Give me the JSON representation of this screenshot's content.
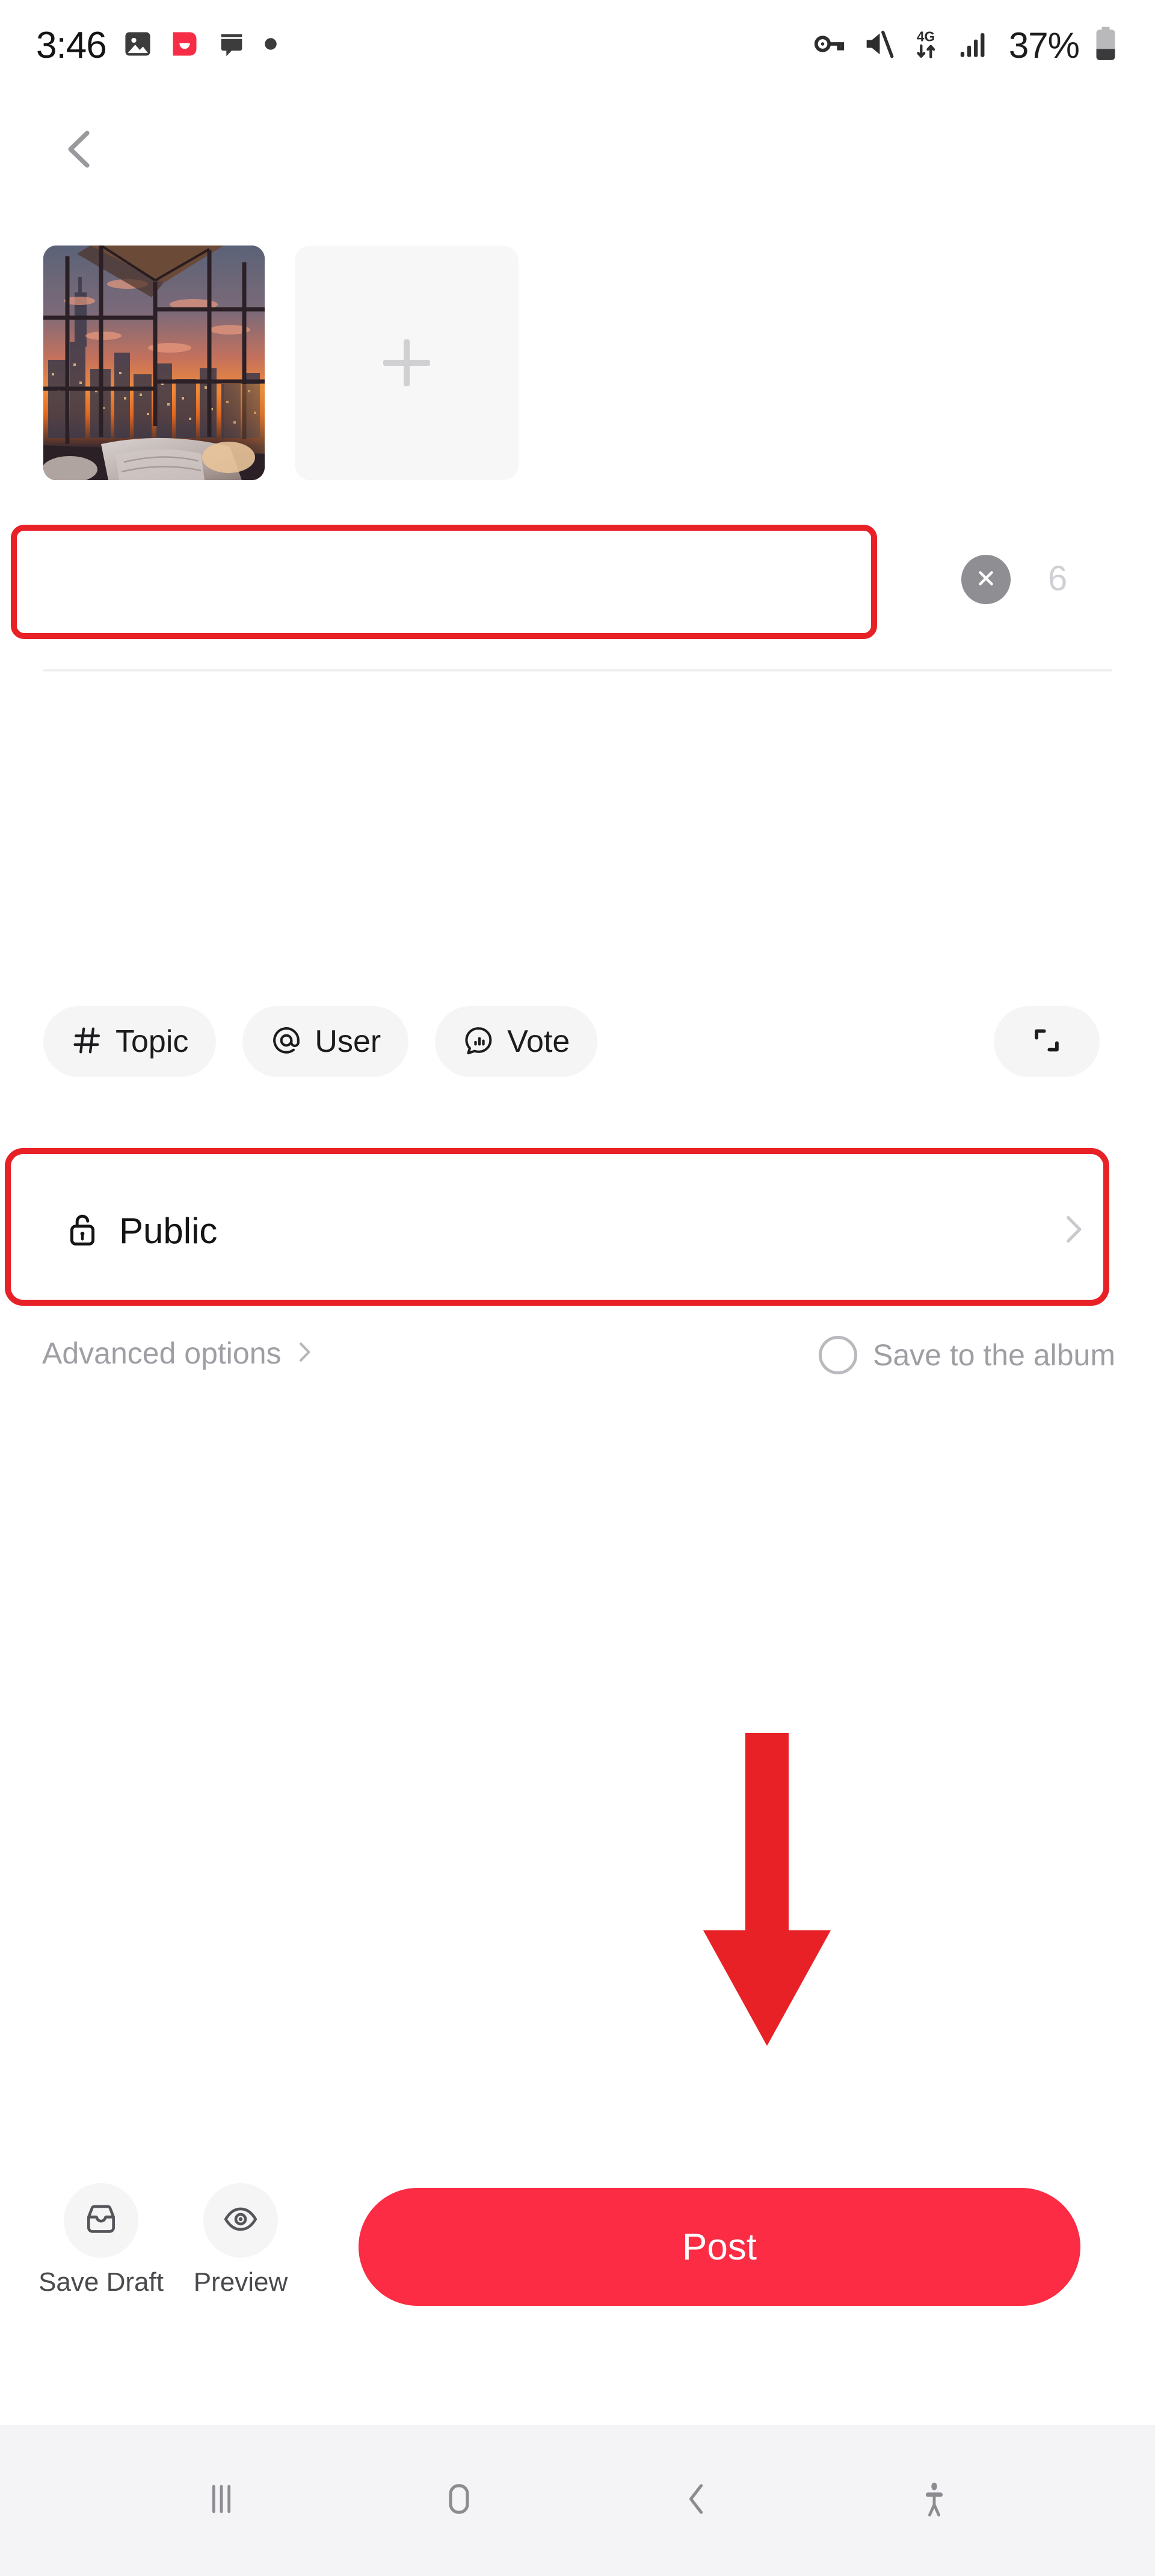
{
  "status_bar": {
    "time": "3:46",
    "battery_percent": "37%",
    "network": "4G",
    "left_icons": [
      "photo-icon",
      "app-smile-icon",
      "chat-bubble-icon",
      "dot-icon"
    ],
    "right_icons": [
      "vpn-key-icon",
      "volume-muted-icon",
      "4g-data-icon",
      "signal-bars-icon",
      "battery-icon"
    ]
  },
  "topnav": {
    "back_icon": "chevron-left-icon"
  },
  "media": {
    "thumbnail_alt": "bedroom with floor-to-ceiling windows overlooking city skyline at sunset",
    "add_label": "+"
  },
  "title_field": {
    "value": "",
    "placeholder": "",
    "clear_icon": "close-circle-icon",
    "counter": "6"
  },
  "chips": [
    {
      "icon": "hash-icon",
      "label": "Topic"
    },
    {
      "icon": "at-icon",
      "label": "User"
    },
    {
      "icon": "poll-bubble-icon",
      "label": "Vote"
    }
  ],
  "expand_button": {
    "icon": "expand-corners-icon"
  },
  "visibility": {
    "icon": "unlock-icon",
    "label": "Public",
    "chevron": "chevron-right-icon"
  },
  "advanced": {
    "label": "Advanced options",
    "chevron": "chevron-right-icon",
    "save_album_label": "Save to the album",
    "save_album_checked": false
  },
  "bottom_bar": {
    "save_draft": {
      "icon": "inbox-tray-icon",
      "label": "Save Draft"
    },
    "preview": {
      "icon": "eye-icon",
      "label": "Preview"
    },
    "post": {
      "label": "Post"
    }
  },
  "android_nav": {
    "recents": "recents-icon",
    "home": "home-icon",
    "back": "back-icon",
    "accessibility": "accessibility-icon"
  },
  "annotations": {
    "title_highlight": "red-rectangle",
    "visibility_highlight": "red-rectangle",
    "pointer": "red-down-arrow"
  },
  "colors": {
    "accent_red": "#fb2c43",
    "annotation_red": "#e82127",
    "chip_bg": "#f5f5f6",
    "nav_bg": "#f4f4f6",
    "muted_text": "#9e9ea4"
  }
}
